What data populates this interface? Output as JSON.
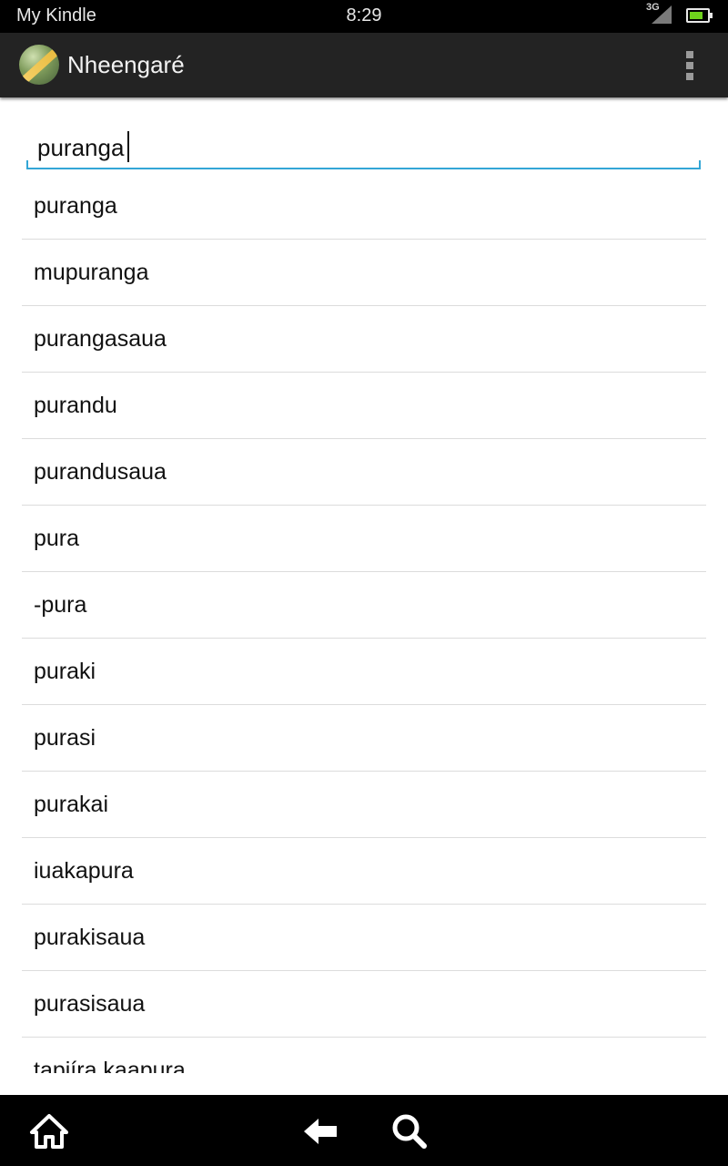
{
  "status_bar": {
    "carrier_label": "My Kindle",
    "time": "8:29",
    "network_type": "3G",
    "battery_level": 0.75,
    "battery_color": "#6fd21c"
  },
  "action_bar": {
    "app_icon": "app-logo-icon",
    "title": "Nheengaré",
    "menu_icon": "overflow-menu-icon"
  },
  "search": {
    "value": "puranga",
    "accent_color": "#33a6d6"
  },
  "results": [
    "puranga",
    "mupuranga",
    "purangasaua",
    "purandu",
    "purandusaua",
    "pura",
    "-pura",
    "puraki",
    "purasi",
    "purakai",
    "iuakapura",
    "purakisaua",
    "purasisaua",
    "tapiíra kaapura"
  ],
  "bottom_nav": {
    "home_icon": "home-icon",
    "back_icon": "back-arrow-icon",
    "search_icon": "search-icon"
  }
}
